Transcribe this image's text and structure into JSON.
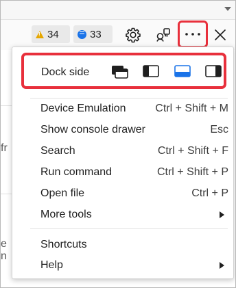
{
  "toolbar": {
    "warnings_count": "34",
    "issues_count": "33",
    "icons": [
      "warning-icon",
      "message-icon",
      "gear-icon",
      "remote-devices-icon",
      "more-dots-icon",
      "close-icon"
    ]
  },
  "background_fragments": {
    "frag1": "fr",
    "frag2": "e n"
  },
  "menu": {
    "dock_side_label": "Dock side",
    "dock_options": [
      "undock-into-separate-window",
      "dock-to-left",
      "dock-to-bottom",
      "dock-to-right"
    ],
    "dock_selected": "dock-to-bottom",
    "items": [
      {
        "label": "Device Emulation",
        "shortcut": "Ctrl + Shift + M"
      },
      {
        "label": "Show console drawer",
        "shortcut": "Esc"
      },
      {
        "label": "Search",
        "shortcut": "Ctrl + Shift + F"
      },
      {
        "label": "Run command",
        "shortcut": "Ctrl + Shift + P"
      },
      {
        "label": "Open file",
        "shortcut": "Ctrl + P"
      },
      {
        "label": "More tools",
        "shortcut": ""
      },
      {
        "label": "Shortcuts",
        "shortcut": ""
      },
      {
        "label": "Help",
        "shortcut": ""
      }
    ]
  },
  "colors": {
    "highlight_red": "#e8303c",
    "accent_blue": "#1a73e8",
    "warning_yellow": "#e6a700"
  }
}
